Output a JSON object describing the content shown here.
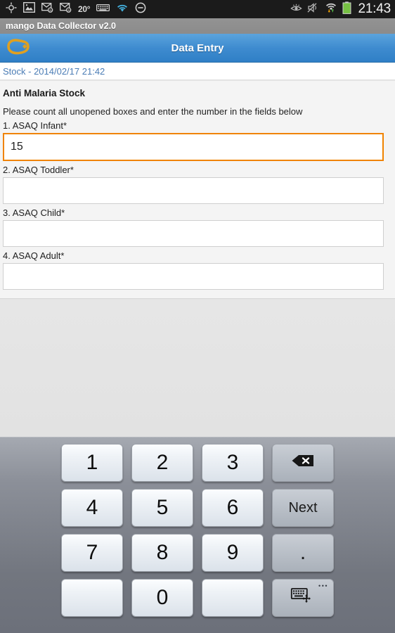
{
  "status_bar": {
    "temperature": "20°",
    "clock": "21:43",
    "left_icons": [
      "gps-crosshair-icon",
      "photo-icon",
      "email-attachment-icon",
      "email-attachment-icon",
      "keyboard-icon",
      "wifi-icon",
      "do-not-disturb-icon"
    ],
    "right_icons": [
      "smart-stay-eye-icon",
      "mute-vibrate-icon",
      "wifi-transfer-icon",
      "battery-icon"
    ],
    "background": "#1b1b1b",
    "battery_color": "#76c043"
  },
  "app_bar": {
    "title": "mango Data Collector v2.0"
  },
  "action_bar": {
    "title": "Data Entry",
    "logo_name": "mango-logo-icon",
    "logo_color": "#e0a020",
    "accent": "#3e8bcf"
  },
  "sub_header": {
    "text": "Stock - 2014/02/17 21:42",
    "color": "#4a7cb5"
  },
  "form": {
    "section_title": "Anti Malaria Stock",
    "description": "Please count all unopened boxes and enter the number in the fields below",
    "focus_color": "#f08300",
    "fields": [
      {
        "label": "1. ASAQ Infant*",
        "value": "15",
        "placeholder": "",
        "focused": true
      },
      {
        "label": "2. ASAQ Toddler*",
        "value": "",
        "placeholder": "",
        "focused": false
      },
      {
        "label": "3. ASAQ Child*",
        "value": "",
        "placeholder": "",
        "focused": false
      },
      {
        "label": "4. ASAQ Adult*",
        "value": "",
        "placeholder": "",
        "focused": false
      }
    ]
  },
  "keyboard": {
    "rows": [
      [
        {
          "label": "1",
          "type": "num",
          "name": "key-1"
        },
        {
          "label": "2",
          "type": "num",
          "name": "key-2"
        },
        {
          "label": "3",
          "type": "num",
          "name": "key-3"
        },
        {
          "label": "",
          "type": "fn",
          "name": "backspace-key",
          "icon": "backspace-icon"
        }
      ],
      [
        {
          "label": "4",
          "type": "num",
          "name": "key-4"
        },
        {
          "label": "5",
          "type": "num",
          "name": "key-5"
        },
        {
          "label": "6",
          "type": "num",
          "name": "key-6"
        },
        {
          "label": "Next",
          "type": "fn",
          "name": "next-key"
        }
      ],
      [
        {
          "label": "7",
          "type": "num",
          "name": "key-7"
        },
        {
          "label": "8",
          "type": "num",
          "name": "key-8"
        },
        {
          "label": "9",
          "type": "num",
          "name": "key-9"
        },
        {
          "label": ".",
          "type": "fn",
          "name": "period-key"
        }
      ],
      [
        {
          "label": "",
          "type": "num",
          "name": "blank-key-left"
        },
        {
          "label": "0",
          "type": "num",
          "name": "key-0"
        },
        {
          "label": "",
          "type": "num",
          "name": "blank-key-right"
        },
        {
          "label": "",
          "type": "fn",
          "name": "keyboard-settings-key",
          "icon": "keyboard-switch-icon",
          "dots": "•••"
        }
      ]
    ]
  }
}
